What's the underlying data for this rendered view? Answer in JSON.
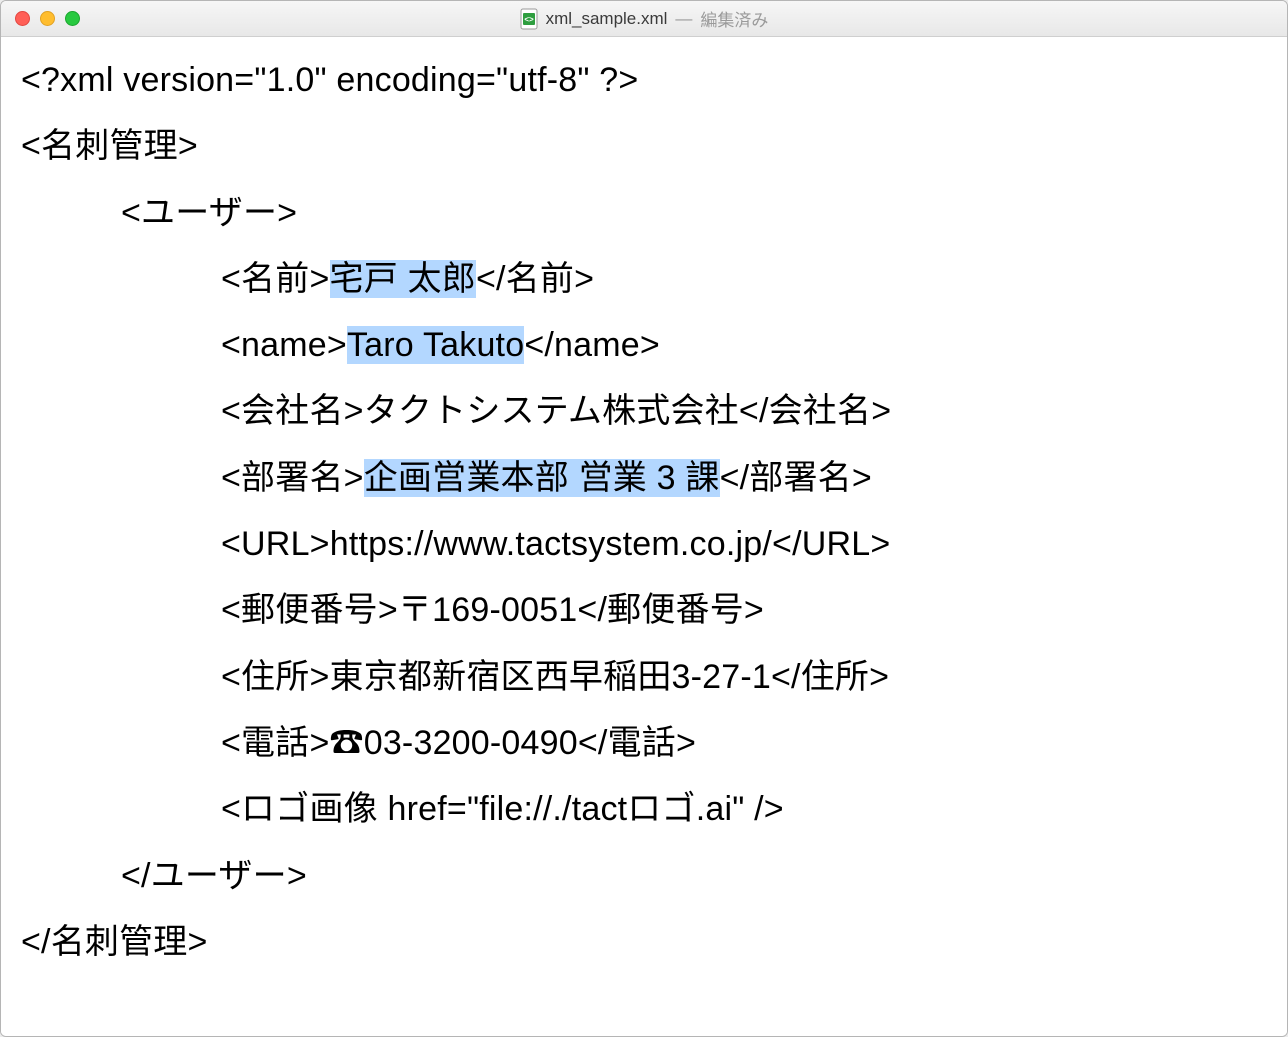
{
  "titlebar": {
    "filename": "xml_sample.xml",
    "separator": "—",
    "status": "編集済み"
  },
  "xml": {
    "decl": "<?xml version=\"1.0\" encoding=\"utf-8\" ?>",
    "root_open": "<名刺管理>",
    "user_open": "<ユーザー>",
    "name_jp_open": "<名前>",
    "name_jp_val": "宅戸 太郎",
    "name_jp_close": "</名前>",
    "name_en_open": "<name>",
    "name_en_val": "Taro Takuto",
    "name_en_close": "</name>",
    "company_open": "<会社名>",
    "company_val": "タクトシステム株式会社",
    "company_close": "</会社名>",
    "dept_open": "<部署名>",
    "dept_val": "企画営業本部 営業 3 課",
    "dept_close": "</部署名>",
    "url_open": "<URL>",
    "url_val": "https://www.tactsystem.co.jp/",
    "url_close": "</URL>",
    "postal_open": "<郵便番号>",
    "postal_val": "〒169-0051",
    "postal_close": "</郵便番号>",
    "addr_open": "<住所>",
    "addr_val": "東京都新宿区西早稲田3-27-1",
    "addr_close": "</住所>",
    "tel_open": "<電話>",
    "tel_val": "☎03-3200-0490",
    "tel_close": "</電話>",
    "logo_line": "<ロゴ画像 href=\"file://./tactロゴ.ai\" />",
    "user_close": "</ユーザー>",
    "root_close": "</名刺管理>"
  }
}
